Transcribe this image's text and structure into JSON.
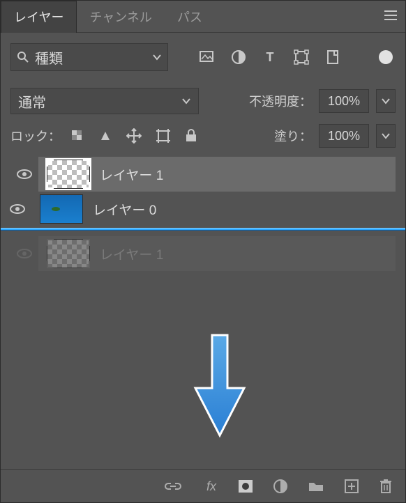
{
  "tabs": {
    "layers": "レイヤー",
    "channels": "チャンネル",
    "paths": "パス"
  },
  "filter": {
    "label": "種類"
  },
  "blend": {
    "label": "通常"
  },
  "opacity": {
    "label": "不透明度：",
    "value": "100%"
  },
  "lock": {
    "label": "ロック："
  },
  "fill": {
    "label": "塗り：",
    "value": "100%"
  },
  "layers": [
    {
      "name": "レイヤー 1"
    },
    {
      "name": "レイヤー 0"
    },
    {
      "name": "レイヤー 1"
    }
  ]
}
